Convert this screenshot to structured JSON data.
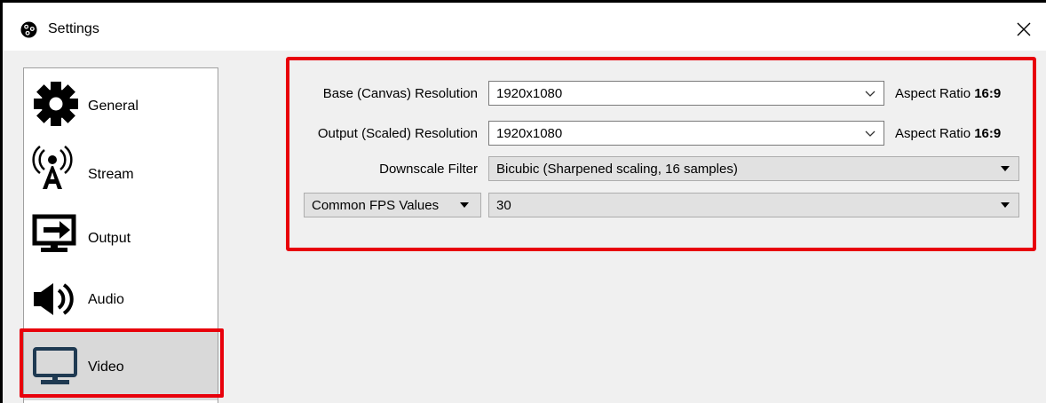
{
  "window": {
    "title": "Settings",
    "close_glyph": "✕"
  },
  "sidebar": {
    "items": [
      {
        "label": "General",
        "icon": "gear-icon"
      },
      {
        "label": "Stream",
        "icon": "broadcast-icon"
      },
      {
        "label": "Output",
        "icon": "output-monitor-icon"
      },
      {
        "label": "Audio",
        "icon": "speaker-icon"
      },
      {
        "label": "Video",
        "icon": "monitor-icon",
        "selected": true
      }
    ]
  },
  "video": {
    "base_resolution": {
      "label": "Base (Canvas) Resolution",
      "value": "1920x1080",
      "aspect_prefix": "Aspect Ratio",
      "aspect_value": "16:9"
    },
    "output_resolution": {
      "label": "Output (Scaled) Resolution",
      "value": "1920x1080",
      "aspect_prefix": "Aspect Ratio",
      "aspect_value": "16:9"
    },
    "downscale_filter": {
      "label": "Downscale Filter",
      "value": "Bicubic (Sharpened scaling, 16 samples)"
    },
    "fps": {
      "type_label": "Common FPS Values",
      "value": "30"
    }
  },
  "colors": {
    "highlight": "#e8000b",
    "selected_item": "#d9d9d9",
    "client_bg": "#f0f0f0"
  }
}
